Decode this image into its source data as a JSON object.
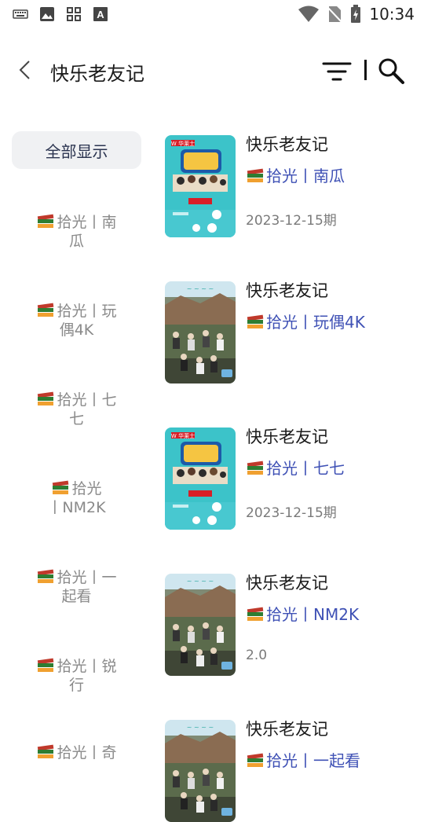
{
  "status_bar": {
    "time": "10:34"
  },
  "header": {
    "title": "快乐老友记"
  },
  "sidebar": {
    "all_label": "全部显示",
    "items": [
      {
        "line1": "拾光丨南",
        "line2": "瓜"
      },
      {
        "line1": "拾光丨玩",
        "line2": "偶4K"
      },
      {
        "line1": "拾光丨七",
        "line2": "七"
      },
      {
        "line1": "拾光",
        "line2": "丨NM2K"
      },
      {
        "line1": "拾光丨一",
        "line2": "起看"
      },
      {
        "line1": "拾光丨锐",
        "line2": "行"
      },
      {
        "line1": "拾光丨奇",
        "line2": ""
      }
    ]
  },
  "results": [
    {
      "title": "快乐老友记",
      "source": "拾光丨南瓜",
      "meta": "2023-12-15期",
      "poster": "teal"
    },
    {
      "title": "快乐老友记",
      "source": "拾光丨玩偶4K",
      "meta": "",
      "poster": "village"
    },
    {
      "title": "快乐老友记",
      "source": "拾光丨七七",
      "meta": "2023-12-15期",
      "poster": "teal"
    },
    {
      "title": "快乐老友记",
      "source": "拾光丨NM2K",
      "meta": "2.0",
      "poster": "village"
    },
    {
      "title": "快乐老友记",
      "source": "拾光丨一起看",
      "meta": "",
      "poster": "village"
    }
  ],
  "colors": {
    "source_text": "#3f51b5",
    "sidebar_text": "#8a8a8a",
    "chip_bg": "#f0f1f3"
  }
}
